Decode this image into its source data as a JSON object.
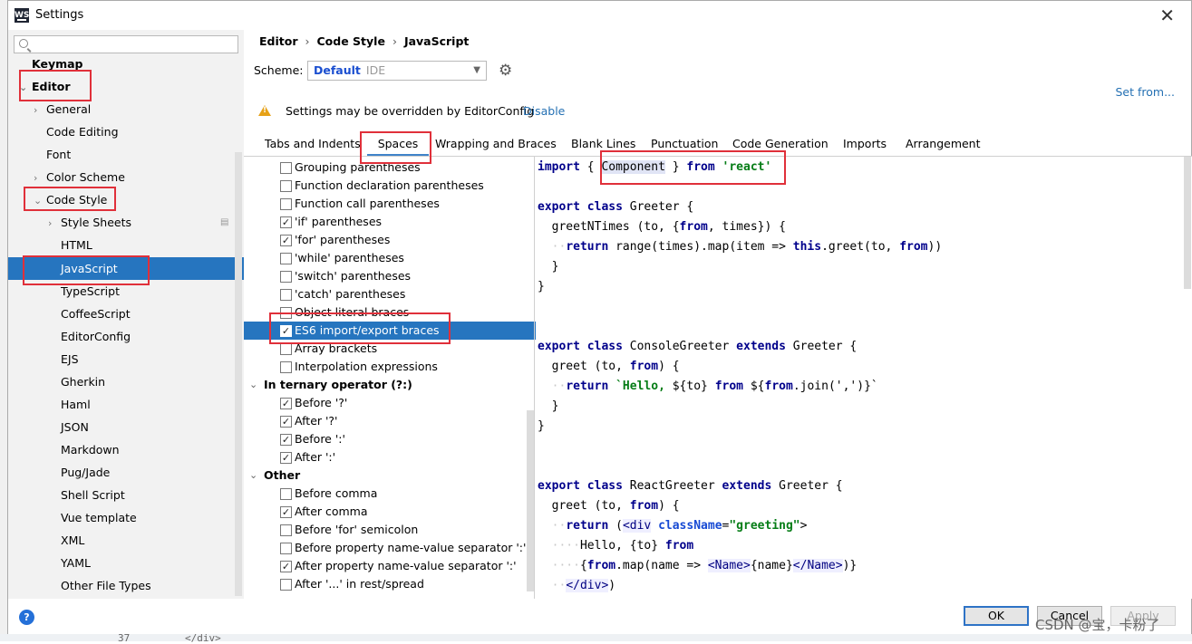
{
  "window": {
    "title": "Settings",
    "app_icon_text": "WS"
  },
  "search": {
    "placeholder": ""
  },
  "sidebar": {
    "items": [
      {
        "label": "Keymap"
      },
      {
        "label": "Editor"
      },
      {
        "label": "General"
      },
      {
        "label": "Code Editing"
      },
      {
        "label": "Font"
      },
      {
        "label": "Color Scheme"
      },
      {
        "label": "Code Style"
      },
      {
        "label": "Style Sheets"
      },
      {
        "label": "HTML"
      },
      {
        "label": "JavaScript"
      },
      {
        "label": "TypeScript"
      },
      {
        "label": "CoffeeScript"
      },
      {
        "label": "EditorConfig"
      },
      {
        "label": "EJS"
      },
      {
        "label": "Gherkin"
      },
      {
        "label": "Haml"
      },
      {
        "label": "JSON"
      },
      {
        "label": "Markdown"
      },
      {
        "label": "Pug/Jade"
      },
      {
        "label": "Shell Script"
      },
      {
        "label": "Vue template"
      },
      {
        "label": "XML"
      },
      {
        "label": "YAML"
      },
      {
        "label": "Other File Types"
      }
    ],
    "selected": "JavaScript"
  },
  "breadcrumb": {
    "items": [
      "Editor",
      "Code Style",
      "JavaScript"
    ],
    "separator": "›"
  },
  "scheme": {
    "label": "Scheme:",
    "value": "Default",
    "suffix": "IDE"
  },
  "set_from": "Set from...",
  "warning": {
    "text": "Settings may be overridden by EditorConfig",
    "link": "Disable"
  },
  "tabs": [
    {
      "label": "Tabs and Indents"
    },
    {
      "label": "Spaces"
    },
    {
      "label": "Wrapping and Braces"
    },
    {
      "label": "Blank Lines"
    },
    {
      "label": "Punctuation"
    },
    {
      "label": "Code Generation"
    },
    {
      "label": "Imports"
    },
    {
      "label": "Arrangement"
    }
  ],
  "active_tab": "Spaces",
  "options": [
    {
      "label": "Grouping parentheses",
      "checked": false
    },
    {
      "label": "Function declaration parentheses",
      "checked": false
    },
    {
      "label": "Function call parentheses",
      "checked": false
    },
    {
      "label": "'if' parentheses",
      "checked": true
    },
    {
      "label": "'for' parentheses",
      "checked": true
    },
    {
      "label": "'while' parentheses",
      "checked": false
    },
    {
      "label": "'switch' parentheses",
      "checked": false
    },
    {
      "label": "'catch' parentheses",
      "checked": false
    },
    {
      "label": "Object literal braces",
      "checked": false
    },
    {
      "label": "ES6 import/export braces",
      "checked": true,
      "selected": true
    },
    {
      "label": "Array brackets",
      "checked": false
    },
    {
      "label": "Interpolation expressions",
      "checked": false
    }
  ],
  "groups": [
    {
      "label": "In ternary operator (?:)",
      "options": [
        {
          "label": "Before '?'",
          "checked": true
        },
        {
          "label": "After '?'",
          "checked": true
        },
        {
          "label": "Before ':'",
          "checked": true
        },
        {
          "label": "After ':'",
          "checked": true
        }
      ]
    },
    {
      "label": "Other",
      "options": [
        {
          "label": "Before comma",
          "checked": false
        },
        {
          "label": "After comma",
          "checked": true
        },
        {
          "label": "Before 'for' semicolon",
          "checked": false
        },
        {
          "label": "Before property name-value separator ':'",
          "checked": false
        },
        {
          "label": "After property name-value separator ':'",
          "checked": true
        },
        {
          "label": "After '...' in rest/spread",
          "checked": false
        }
      ]
    }
  ],
  "code_preview": {
    "lines": [
      "import { Component } from 'react'",
      "",
      "export class Greeter {",
      "  greetNTimes (to, {from, times}) {",
      "    return range(times).map(item => this.greet(to, from))",
      "  }",
      "}",
      "",
      "",
      "export class ConsoleGreeter extends Greeter {",
      "  greet (to, from) {",
      "    return `Hello, ${to} from ${from.join(',')}`",
      "  }",
      "}",
      "",
      "",
      "export class ReactGreeter extends Greeter {",
      "  greet (to, from) {",
      "    return (<div className=\"greeting\">",
      "      Hello, {to} from",
      "      {from.map(name => <Name>{name}</Name>)}",
      "    </div>)",
      "  }",
      "}"
    ]
  },
  "buttons": {
    "ok": "OK",
    "cancel": "Cancel",
    "apply": "Apply"
  },
  "help": "?",
  "watermark": "CSDN @宝，卡粉了",
  "behind": {
    "line_number": "37",
    "code_fragment": "</div>"
  },
  "colors": {
    "selection": "#2675bf",
    "link": "#2470b3",
    "annotation": "#e0303a",
    "keyword": "#00008b",
    "string": "#067d17"
  }
}
